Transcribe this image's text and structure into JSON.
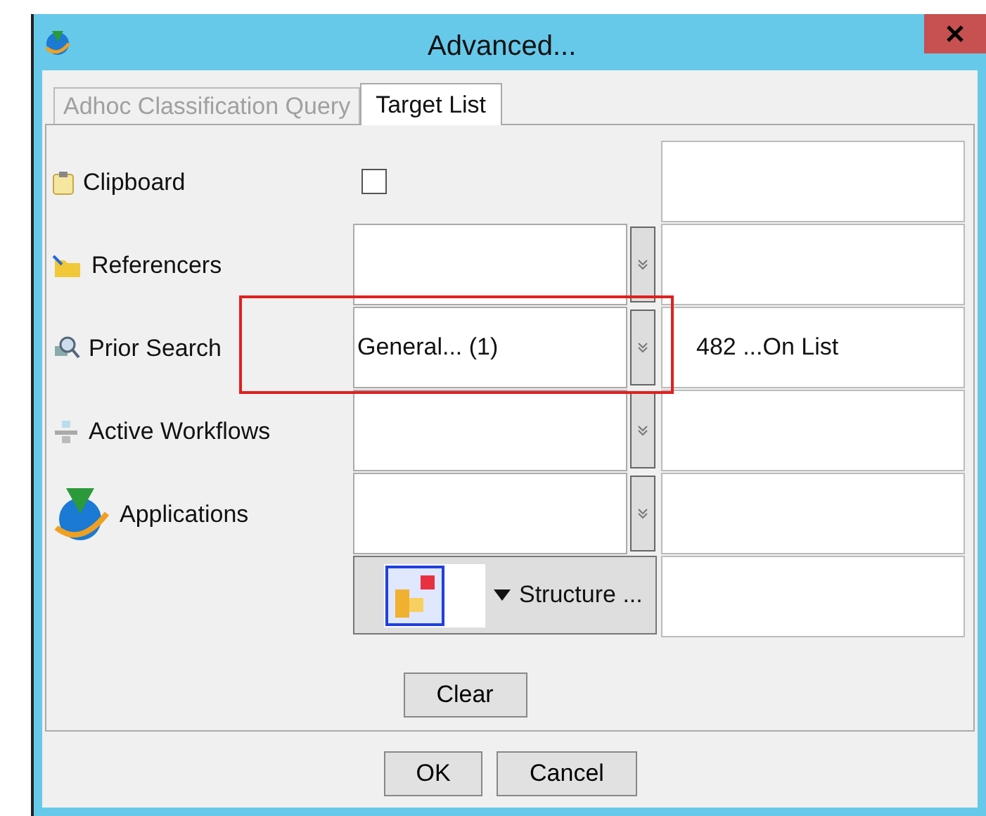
{
  "window": {
    "title": "Advanced..."
  },
  "tabs": [
    {
      "label": "Adhoc Classification Query",
      "selected": false
    },
    {
      "label": "Target List",
      "selected": true
    }
  ],
  "rows": [
    {
      "kind": "checkbox",
      "label": "Clipboard",
      "checked": false
    },
    {
      "kind": "dropdown",
      "label": "Referencers"
    },
    {
      "kind": "dropdown",
      "label": "Prior Search",
      "value": "General... (1)",
      "result": "482 ...On List",
      "highlighted": true
    },
    {
      "kind": "dropdown",
      "label": "Active Workflows"
    },
    {
      "kind": "dropdown",
      "label": "Applications"
    },
    {
      "kind": "menu_button",
      "label": "Structure ..."
    }
  ],
  "clear_button": "Clear",
  "buttons": [
    "OK",
    "Cancel"
  ]
}
